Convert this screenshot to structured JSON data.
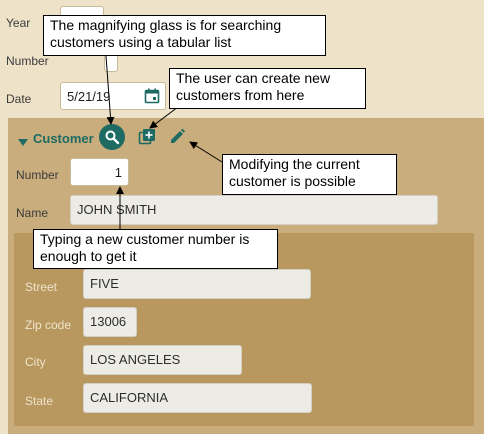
{
  "top_form": {
    "year_label": "Year",
    "number_label": "Number",
    "date_label": "Date",
    "date_value": "5/21/19"
  },
  "customer": {
    "section_label": "Customer",
    "number_label": "Number",
    "number_value": "1",
    "name_label": "Name",
    "name_value": "JOHN SMITH",
    "street_label": "Street",
    "street_value": "FIVE",
    "zip_label": "Zip code",
    "zip_value": "13006",
    "city_label": "City",
    "city_value": "LOS ANGELES",
    "state_label": "State",
    "state_value": "CALIFORNIA"
  },
  "callouts": {
    "search": "The magnifying glass is for searching customers using a tabular list",
    "create": "The user can create new customers from here",
    "modify": "Modifying the current customer is possible",
    "typing": "Typing a new customer number is enough to get it"
  },
  "icons": {
    "search": "search-icon",
    "create": "add-icon",
    "edit": "pencil-icon",
    "calendar": "calendar-icon",
    "expand": "triangle-down-icon"
  },
  "colors": {
    "page_bg": "#eee3c9",
    "panel_outer": "#c9ad7c",
    "panel_inner": "#b8985e",
    "accent_teal": "#1d6b63"
  }
}
